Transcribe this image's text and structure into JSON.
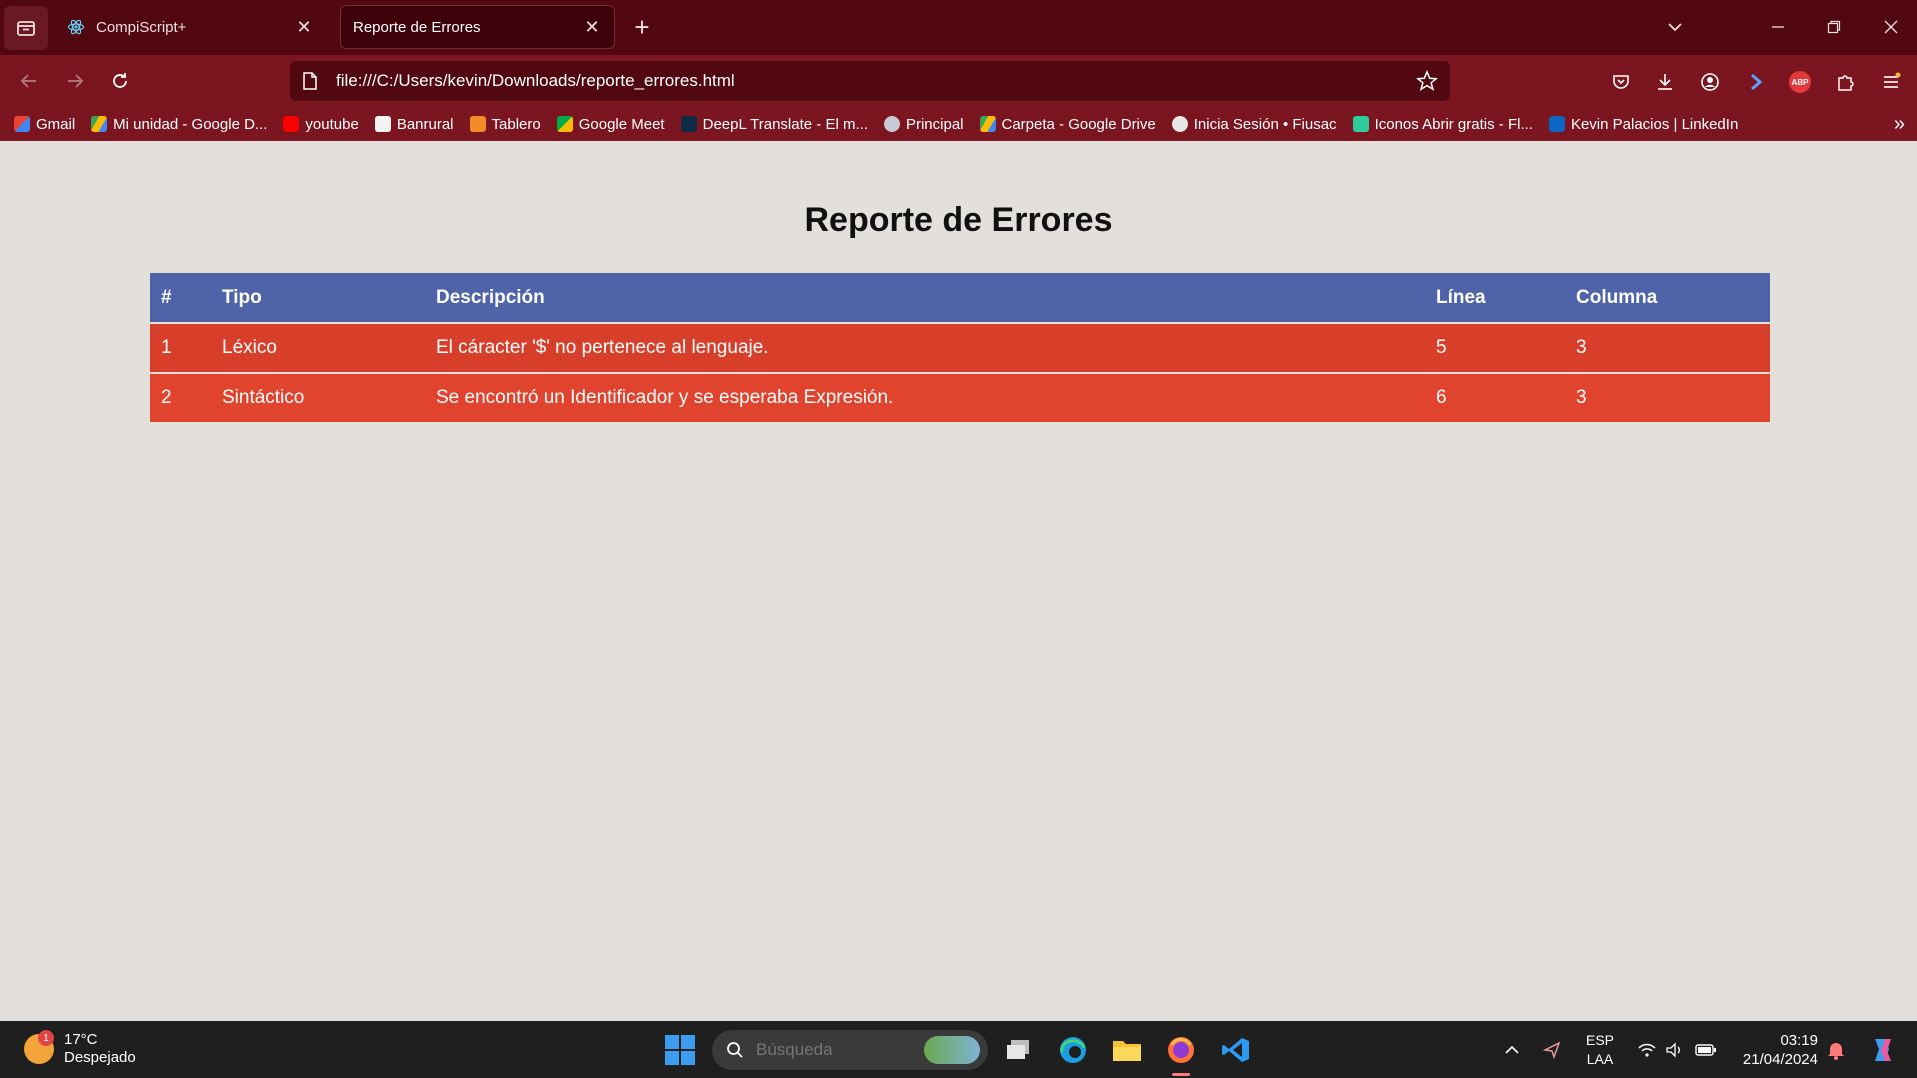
{
  "browser": {
    "tabs": [
      {
        "title": "CompiScript+",
        "active": false
      },
      {
        "title": "Reporte de Errores",
        "active": true
      }
    ],
    "url": "file:///C:/Users/kevin/Downloads/reporte_errores.html",
    "bookmarks": [
      {
        "label": "Gmail",
        "icon": "gmail-icon"
      },
      {
        "label": "Mi unidad - Google D...",
        "icon": "google-drive-icon"
      },
      {
        "label": "youtube",
        "icon": "youtube-icon"
      },
      {
        "label": "Banrural",
        "icon": "banrural-icon"
      },
      {
        "label": "Tablero",
        "icon": "tablero-icon"
      },
      {
        "label": "Google Meet",
        "icon": "google-meet-icon"
      },
      {
        "label": "DeepL Translate - El m...",
        "icon": "deepl-icon"
      },
      {
        "label": "Principal",
        "icon": "globe-icon"
      },
      {
        "label": "Carpeta - Google Drive",
        "icon": "google-drive-icon"
      },
      {
        "label": "Inicia Sesión • Fiusac",
        "icon": "fiusac-icon"
      },
      {
        "label": "Iconos Abrir gratis - Fl...",
        "icon": "flaticon-icon"
      },
      {
        "label": "Kevin Palacios | LinkedIn",
        "icon": "linkedin-icon"
      }
    ],
    "colors": {
      "tabbar": "#520810",
      "toolbar": "#7b1520"
    }
  },
  "page": {
    "title": "Reporte de Errores",
    "table": {
      "headers": [
        "#",
        "Tipo",
        "Descripción",
        "Línea",
        "Columna"
      ],
      "rows": [
        [
          "1",
          "Léxico",
          "El cáracter '$' no pertenece al lenguaje.",
          "5",
          "3"
        ],
        [
          "2",
          "Sintáctico",
          "Se encontró un Identificador y se esperaba Expresión.",
          "6",
          "3"
        ]
      ],
      "colors": {
        "header": "#4f64a8",
        "row": "#d83f2b"
      }
    }
  },
  "taskbar": {
    "weather": {
      "temp": "17°C",
      "condition": "Despejado",
      "badge": "1"
    },
    "search_placeholder": "Búsqueda",
    "language": {
      "line1": "ESP",
      "line2": "LAA"
    },
    "time": "03:19",
    "date": "21/04/2024"
  }
}
